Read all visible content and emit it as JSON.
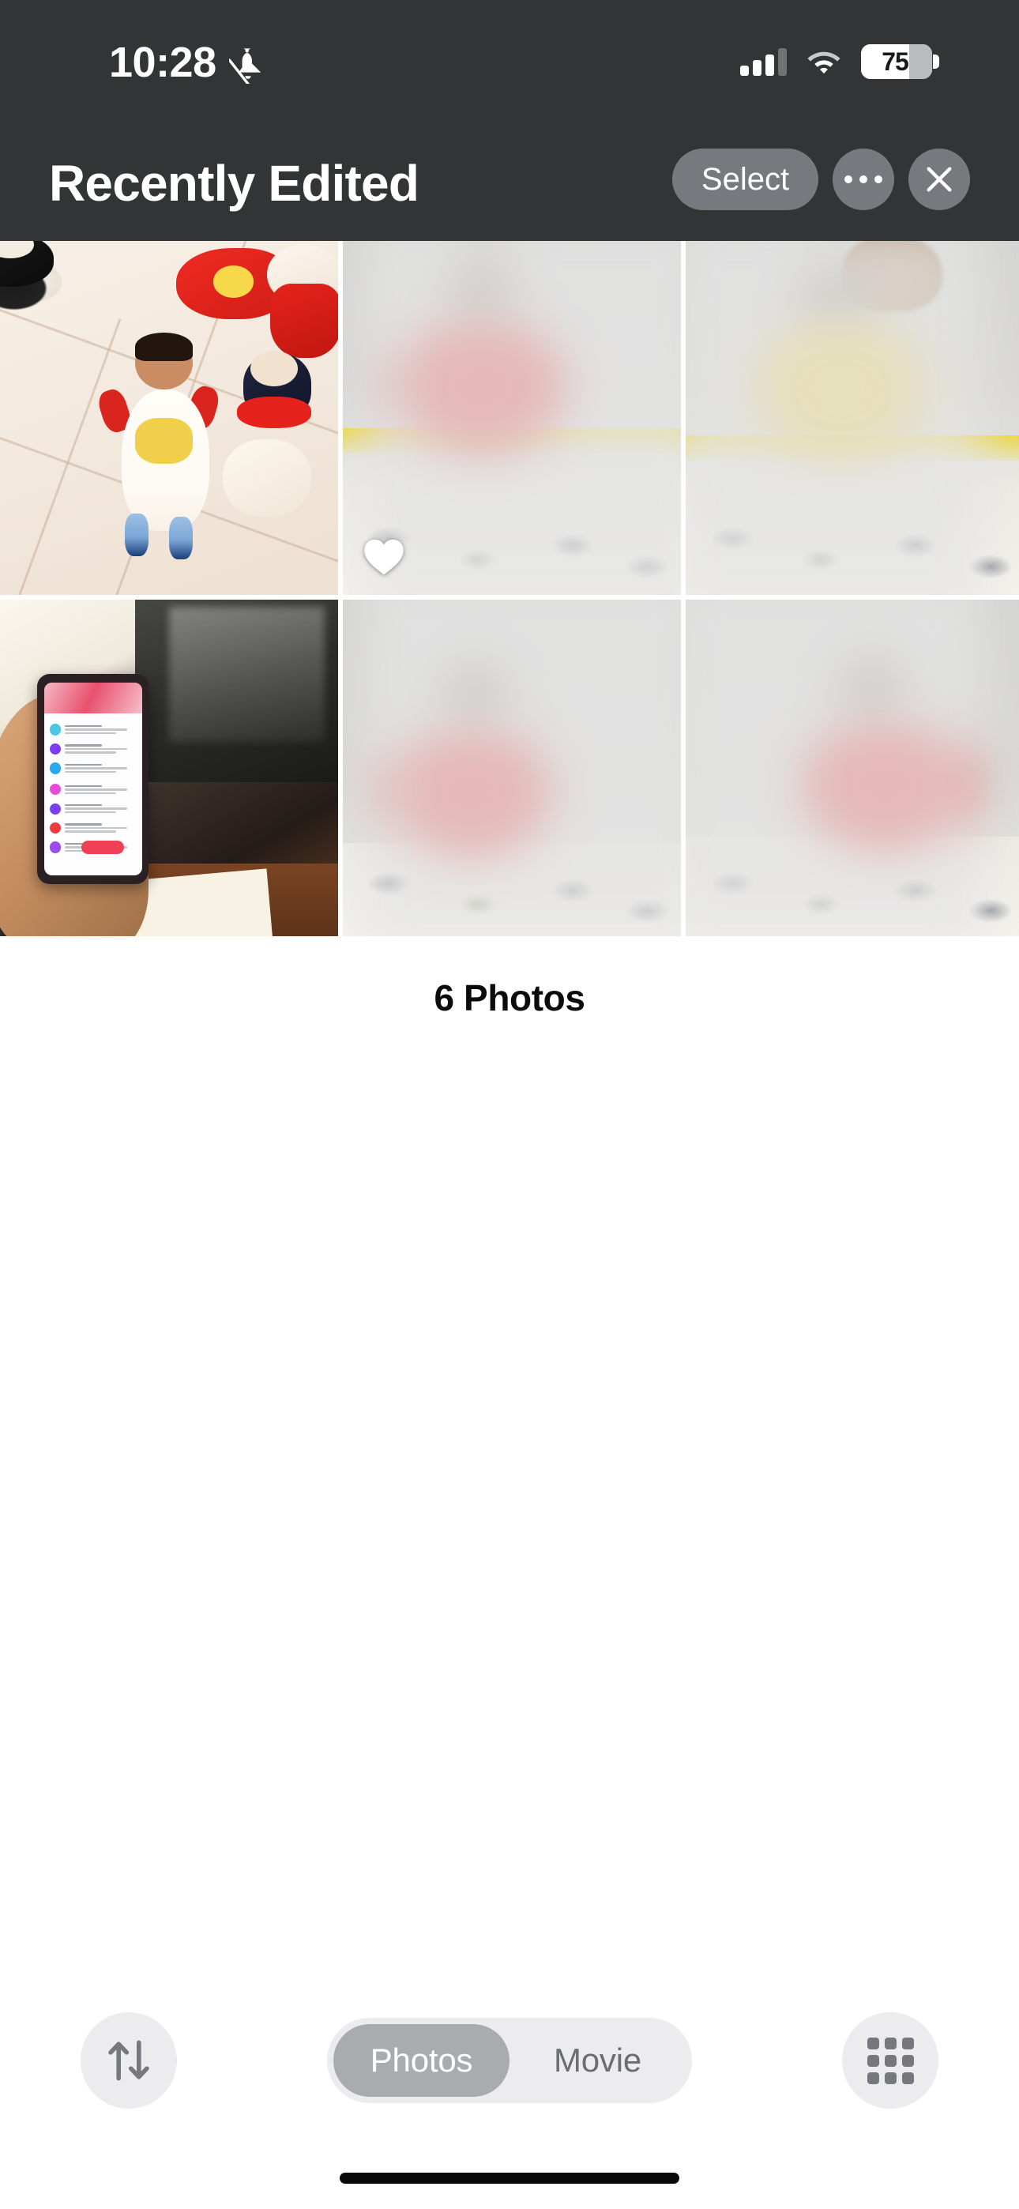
{
  "status_bar": {
    "time": "10:28",
    "silent_mode_icon": "bell-slash-icon",
    "cellular_icon": "cellular-signal-icon",
    "cellular_bars_filled": 3,
    "cellular_bars_total": 4,
    "wifi_icon": "wifi-icon",
    "battery_icon": "battery-icon",
    "battery_percent": "75",
    "battery_level": 75
  },
  "header": {
    "title": "Recently Edited",
    "select_label": "Select",
    "more_icon": "ellipsis-icon",
    "close_icon": "close-x-icon"
  },
  "grid": {
    "photos": [
      {
        "index": 1,
        "name": "baby-on-tiled-floor-with-plush-toys",
        "favorite": false
      },
      {
        "index": 2,
        "name": "blurred-baby-in-red-outfit-on-bedsheet",
        "favorite": true,
        "favorite_icon": "heart-filled-icon"
      },
      {
        "index": 3,
        "name": "blurred-baby-in-yellow-outfit-with-toddler",
        "favorite": false
      },
      {
        "index": 4,
        "name": "hand-holding-phone-showing-email-inbox",
        "favorite": false
      },
      {
        "index": 5,
        "name": "blurred-baby-in-red-outfit-sitting",
        "favorite": false
      },
      {
        "index": 6,
        "name": "blurred-baby-in-red-outfit-on-bed",
        "favorite": false
      }
    ]
  },
  "summary": {
    "count_label": "6 Photos"
  },
  "toolbar": {
    "sort_icon": "sort-arrows-icon",
    "grid_icon": "grid-view-icon",
    "segments": [
      {
        "label": "Photos",
        "selected": true
      },
      {
        "label": "Movie",
        "selected": false
      }
    ]
  },
  "colors": {
    "header_bg": "#333436",
    "page_bg": "#ffffff",
    "control_bg": "#ececee",
    "segment_active_bg": "#a9abaf",
    "text_primary": "#0b0b0b",
    "text_on_dark": "#ffffff",
    "icon_gray": "#76787d"
  }
}
